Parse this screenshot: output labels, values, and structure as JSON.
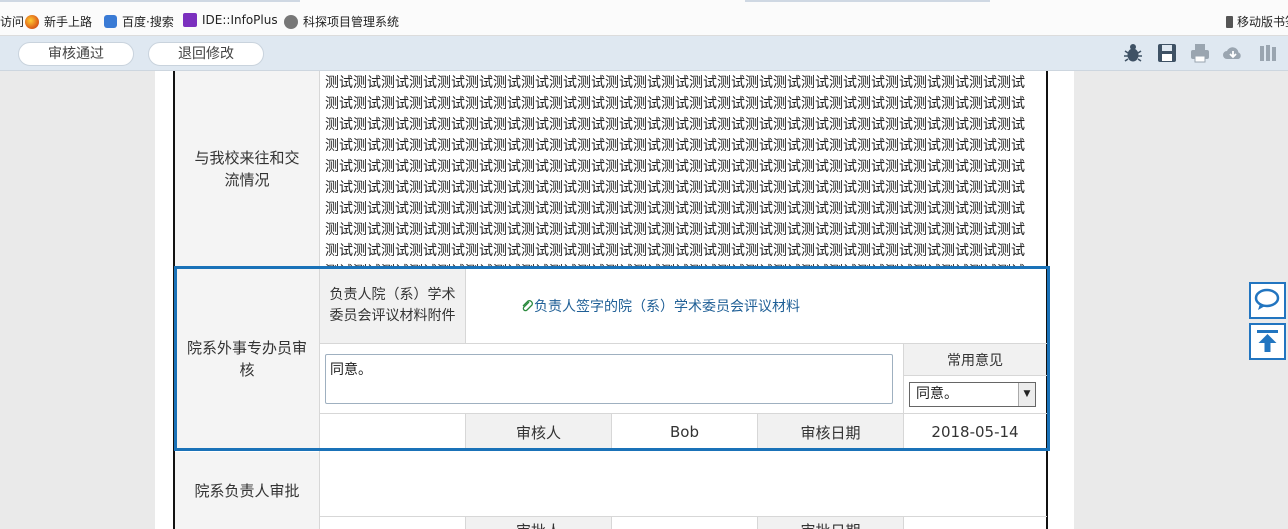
{
  "bookmarks": [
    {
      "label": "访问"
    },
    {
      "label": "新手上路"
    },
    {
      "label": "百度·搜索"
    },
    {
      "label": "IDE::InfoPlus"
    },
    {
      "label": "科探项目管理系统"
    },
    {
      "label": "移动版书签"
    }
  ],
  "toolbar": {
    "approve": "审核通过",
    "reject": "退回修改",
    "icons": [
      "bug-icon",
      "save-icon",
      "print-icon",
      "cloud-download-icon",
      "library-icon"
    ]
  },
  "form": {
    "exchange": {
      "label": "与我校来往和交流情况",
      "text": "测试测试测试测试测试测试测试测试测试测试测试测试测试测试测试测试测试测试测试测试测试测试测试测试测试测试测试测试测试测试测试测试测试测试测试测试测试测试测试测试测试测试测试测试测试测试测试测试测试测试测试测试测试测试测试测试测试测试测试测试测试测试测试测试测试测试测试测试测试测试测试测试测试测试测试测试测试测试测试测试测试测试测试测试测试测试测试测试测试测试测试测试测试测试测试测试测试测试测试测试测试测试测试测试测试测试测试测试测试测试测试测试测试测试测试测试测试测试测试测试测试测试测试测试测试测试测试测试测试测试测试测试测试测试测试测试测试测试测试测试测试测试测试测试测试测试测试测试测试测试测试测试测试测试测试测试测试测试测试测试测试测试测试测试测试测试测试测试测试测试测试测试测试测试测试测试测试测试测试测试测试测试测试测试测试测试测试测试测试测试测试测试测试测试测试测试测试测试测试测试测试测试测试测试测试测试测试测试测试测试测试测试测试测试测试测试测试测试测试测试测试测试测试测试测试测试测试测试测试测试测试测试测试测试测试测试测试测试测试测试测试测试测试测试测试测试测试测试测试测试测试测试测试测试测试测试测试测试测试测试测试测试测试测试测试测试测试测试测试测试测试测试测试测试测试测试测试测试测试测试测试测试测试测试测试测试测试测试测试测试测试测试测试测试测试测试测试测试测试测试测试测试测试测试测试测试测试测试测试测试测试测试测试测试测试测试测试测试测试测试测试测试测试测试测试测试测试测试测试测试测试测试测试测试测试测试测试测试测试测试测试测试测试测试测试测试测试测试测试测试测试测试测试测试测试测试测试测试测试测试测试测试测试测试测试测试测试测试测试测试测试测试测试测试测试测试测试测试测试测试测试测试测试"
    },
    "foreign": {
      "label": "院系外事专办员审核",
      "attach_label": "负责人院（系）学术委员会评议材料附件",
      "attach_link": "负责人签字的院（系）学术委员会评议材料",
      "opinion": "同意。",
      "common_label": "常用意见",
      "common_value": "同意。",
      "reviewer_label": "审核人",
      "reviewer": "Bob",
      "date_label": "审核日期",
      "date": "2018-05-14"
    },
    "leader": {
      "label": "院系负责人审批",
      "reviewer_label": "审批人",
      "date_label": "审批日期"
    }
  },
  "colors": {
    "accent": "#1a72b8"
  }
}
